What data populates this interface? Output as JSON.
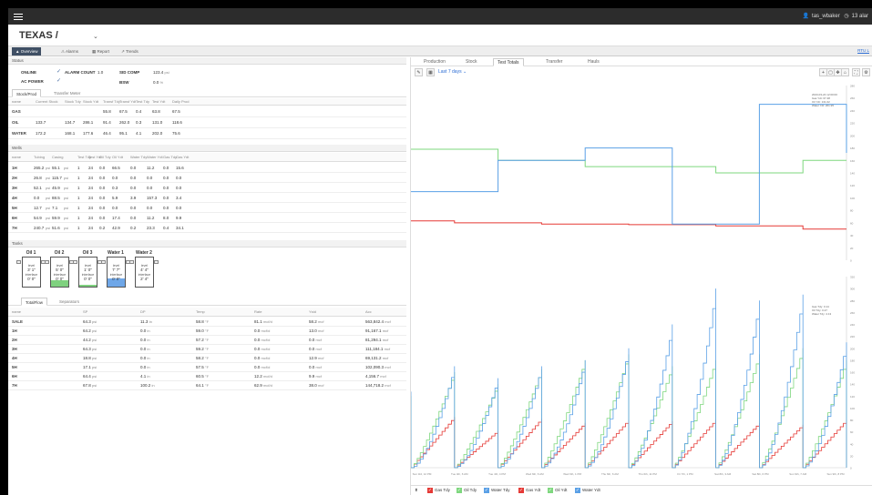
{
  "user": {
    "name": "tas_wbaker",
    "alarms": "13 alar"
  },
  "site": {
    "name": "TEXAS /"
  },
  "nav": {
    "tabs": [
      "Overview",
      "Alarms",
      "Report",
      "Trends"
    ],
    "rtu_link": "RTU L"
  },
  "status": {
    "header": "Status",
    "online": "ONLINE",
    "alarm_count_label": "ALARM COUNT",
    "alarm_count": "1.0",
    "ac_power": "AC POWER",
    "sid_comp_label": "SID COMP",
    "sid_comp_value": "123.4",
    "sid_comp_unit": "psi",
    "bsw_label": "BSW",
    "bsw_value": "0.0",
    "bsw_unit": "%"
  },
  "stock_tabs": [
    "Stock/Prod",
    "Transfer Meter"
  ],
  "stock": {
    "headers": [
      "name",
      "Current Stock",
      "Stock Tdy",
      "Stock Ydt",
      "Transf Tdy",
      "Transf Ydt",
      "Test Tdy",
      "Test Ydt",
      "Daily Prod"
    ],
    "rows": [
      {
        "name": "GAS",
        "cur": "",
        "stdy": "",
        "sydt": "",
        "ttdy": "55.8",
        "tydt": "67.5",
        "xtdy": "0.4",
        "xydt": "63.8",
        "daily": "67.5"
      },
      {
        "name": "OIL",
        "cur": "133.7",
        "stdy": "134.7",
        "sydt": "286.1",
        "ttdy": "91.4",
        "tydt": "262.0",
        "xtdy": "0.3",
        "xydt": "131.0",
        "daily": "118.6"
      },
      {
        "name": "WATER",
        "cur": "172.2",
        "stdy": "168.1",
        "sydt": "177.6",
        "ttdy": "46.4",
        "tydt": "95.1",
        "xtdy": "4.1",
        "xydt": "202.0",
        "daily": "75.6"
      }
    ]
  },
  "wells": {
    "header": "Wells",
    "headers": [
      "name",
      "Tubing",
      "Casing",
      "Test Tdy",
      "Test Ydt",
      "Oil Tdy",
      "Oil Ydt",
      "Water Tdy",
      "Water Ydt",
      "Gas Tdy",
      "Gas Ydt"
    ],
    "rows": [
      {
        "name": "1H",
        "tub": "265.2",
        "cas": "55.1",
        "tt": "1",
        "ty": "24",
        "ot": "0.0",
        "oy": "66.5",
        "wt": "0.0",
        "wy": "11.2",
        "gt": "0.0",
        "gy": "15.6"
      },
      {
        "name": "2H",
        "tub": "26.8",
        "cas": "115.7",
        "tt": "1",
        "ty": "24",
        "ot": "0.0",
        "oy": "0.0",
        "wt": "0.0",
        "wy": "0.0",
        "gt": "0.0",
        "gy": "0.0"
      },
      {
        "name": "3H",
        "tub": "52.1",
        "cas": "45.9",
        "tt": "1",
        "ty": "24",
        "ot": "0.0",
        "oy": "0.3",
        "wt": "0.0",
        "wy": "0.0",
        "gt": "0.0",
        "gy": "0.0"
      },
      {
        "name": "4H",
        "tub": "0.0",
        "cas": "88.5",
        "tt": "1",
        "ty": "24",
        "ot": "0.0",
        "oy": "5.9",
        "wt": "3.9",
        "wy": "157.3",
        "gt": "0.0",
        "gy": "3.4"
      },
      {
        "name": "5H",
        "tub": "12.7",
        "cas": "7.1",
        "tt": "1",
        "ty": "24",
        "ot": "0.0",
        "oy": "0.0",
        "wt": "0.0",
        "wy": "0.0",
        "gt": "0.0",
        "gy": "0.0"
      },
      {
        "name": "6H",
        "tub": "54.9",
        "cas": "59.9",
        "tt": "1",
        "ty": "24",
        "ot": "0.0",
        "oy": "17.4",
        "wt": "0.0",
        "wy": "11.2",
        "gt": "8.0",
        "gy": "9.9"
      },
      {
        "name": "7H",
        "tub": "240.7",
        "cas": "51.6",
        "tt": "1",
        "ty": "24",
        "ot": "0.2",
        "oy": "42.9",
        "wt": "0.2",
        "wy": "23.3",
        "gt": "0.4",
        "gy": "34.1"
      }
    ],
    "unit": "psi"
  },
  "tanks": {
    "header": "Tanks",
    "items": [
      {
        "name": "Oil 1",
        "lvl_label": "level",
        "level": "3' 1\"",
        "if_label": "interface",
        "iface": "0' 0\"",
        "fill": 0.0,
        "kind": "oil"
      },
      {
        "name": "Oil 2",
        "lvl_label": "level",
        "level": "5' 0\"",
        "if_label": "interface",
        "iface": "0' 0\"",
        "fill": 0.22,
        "kind": "oil"
      },
      {
        "name": "Oil 3",
        "lvl_label": "level",
        "level": "1' 0\"",
        "if_label": "interface",
        "iface": "0' 0\"",
        "fill": 0.05,
        "kind": "oil"
      },
      {
        "name": "Water 1",
        "lvl_label": "level",
        "level": "7' 7\"",
        "if_label": "interface",
        "iface": "0' 0\"",
        "fill": 0.28,
        "kind": "water"
      },
      {
        "name": "Water 2",
        "lvl_label": "level",
        "level": "4' 4\"",
        "if_label": "interface",
        "iface": "2' 4\"",
        "fill": 0.0,
        "kind": "water"
      }
    ]
  },
  "flow_tabs": [
    "TotalFlow",
    "Separators"
  ],
  "flow": {
    "headers": [
      "name",
      "SP",
      "DP",
      "Temp",
      "Rate",
      "Ystd",
      "Acc"
    ],
    "rows": [
      {
        "name": "SALE",
        "sp": "64.3",
        "dp": "11.3",
        "temp": "58.8",
        "rate": "81.1",
        "ystd": "58.2",
        "acc": "563,842.4"
      },
      {
        "name": "1H",
        "sp": "64.2",
        "dp": "0.0",
        "temp": "59.0",
        "rate": "0.0",
        "ystd": "13.0",
        "acc": "91,167.1"
      },
      {
        "name": "2H",
        "sp": "44.2",
        "dp": "0.0",
        "temp": "57.2",
        "rate": "0.0",
        "ystd": "0.0",
        "acc": "81,294.1"
      },
      {
        "name": "3H",
        "sp": "64.3",
        "dp": "0.0",
        "temp": "59.2",
        "rate": "0.0",
        "ystd": "0.0",
        "acc": "111,184.1"
      },
      {
        "name": "4H",
        "sp": "18.8",
        "dp": "0.0",
        "temp": "58.2",
        "rate": "0.0",
        "ystd": "12.9",
        "acc": "69,131.2"
      },
      {
        "name": "5H",
        "sp": "17.1",
        "dp": "0.0",
        "temp": "57.5",
        "rate": "0.0",
        "ystd": "0.0",
        "acc": "102,090.3"
      },
      {
        "name": "6H",
        "sp": "64.4",
        "dp": "4.1",
        "temp": "60.5",
        "rate": "12.2",
        "ystd": "9.9",
        "acc": "4,156.7"
      },
      {
        "name": "7H",
        "sp": "67.8",
        "dp": "100.2",
        "temp": "64.1",
        "rate": "62.9",
        "ystd": "38.0",
        "acc": "144,718.2"
      }
    ],
    "units": {
      "sp": "psi",
      "dp": "in",
      "temp": "°F",
      "rate": "mcf/d",
      "ystd": "mcf",
      "acc": "mcf"
    }
  },
  "panel": {
    "tabs": [
      "Production",
      "Stock",
      "Test Totals",
      "Transfer",
      "Hauls"
    ],
    "range": "Last 7 days",
    "tooltip_top": [
      "2023-03-24 12:00:00",
      "Gas Ydt: 67.48",
      "Oil Ydt: 131.02",
      "Water Ydt: 201.95"
    ],
    "tooltip_bottom": [
      "Gas Tdy: 0.14",
      "Oil Tdy: 0.27",
      "Water Tdy: 4.13"
    ]
  },
  "colors": {
    "gas": "#e53935",
    "oil": "#7ed77e",
    "water": "#5aa0e6"
  },
  "chart_data": [
    {
      "type": "line",
      "title": "",
      "series": [
        {
          "name": "Gas Ydt",
          "values": [
            63,
            60,
            60,
            58,
            58,
            57,
            57,
            55,
            55,
            50,
            50
          ]
        },
        {
          "name": "Oil Ydt",
          "values": [
            178,
            178,
            160,
            160,
            150,
            150,
            150,
            140,
            140,
            160,
            160
          ]
        },
        {
          "name": "Water Ydt",
          "values": [
            110,
            110,
            160,
            160,
            180,
            180,
            58,
            58,
            250,
            250,
            172
          ]
        }
      ],
      "ylim": [
        0,
        280
      ],
      "yticks": [
        "0",
        "20",
        "40",
        "60",
        "80",
        "100",
        "120",
        "140",
        "160",
        "180",
        "200",
        "220",
        "240",
        "260",
        "280"
      ]
    },
    {
      "type": "line",
      "title": "",
      "series": [
        {
          "name": "Gas Tdy",
          "peaks": [
            85,
            62,
            82,
            75,
            80,
            78,
            80,
            75,
            72,
            80
          ]
        },
        {
          "name": "Oil Tdy",
          "peaks": [
            160,
            140,
            165,
            180,
            190,
            170,
            180,
            190,
            200,
            180
          ]
        },
        {
          "name": "Water Tdy",
          "peaks": [
            170,
            150,
            170,
            180,
            200,
            240,
            300,
            280,
            290,
            210
          ]
        }
      ],
      "ylim": [
        0,
        320
      ],
      "yticks": [
        "0",
        "20",
        "40",
        "60",
        "80",
        "100",
        "120",
        "140",
        "160",
        "180",
        "200",
        "220",
        "240",
        "260",
        "280",
        "300",
        "320"
      ],
      "xticks": [
        "Sun 3rd, 12 PM",
        "Tue 4th, 6 AM",
        "Tue 4th, 4 PM",
        "Wed 6th, 6 AM",
        "Wed 6th, 1 PM",
        "Thu 6th, 6 AM",
        "Thu 6th, 11 PM",
        "Fri 7th, 1 PM",
        "Sat 8th, 3 AM",
        "Sat 8th, 6 PM",
        "Sun 9th, 7 AM",
        "Sun 9th, 8 PM"
      ]
    }
  ],
  "legend": [
    "Gas Tdy",
    "Oil Tdy",
    "Water Tdy",
    "Gas Ydt",
    "Oil Ydt",
    "Water Ydt"
  ]
}
